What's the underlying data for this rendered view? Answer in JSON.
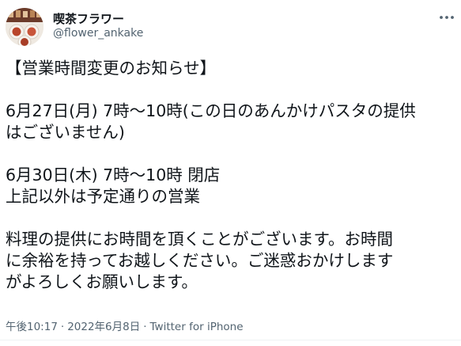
{
  "author": {
    "display_name": "喫茶フラワー",
    "handle": "@flower_ankake",
    "avatar_icon": "avatar-photo-icon"
  },
  "more_icon": "more-horizontal-icon",
  "tweet": {
    "lines": [
      "【営業時間変更のお知らせ】",
      "",
      "6月27日(月) 7時～10時(この日のあんかけパスタの提供",
      "はございません)",
      "",
      "6月30日(木) 7時～10時 閉店",
      "上記以外は予定通りの営業",
      "",
      "料理の提供にお時間を頂くことがございます。お時間",
      "に余裕を持ってお越しください。ご迷惑おかけします",
      "がよろしくお願いします。"
    ]
  },
  "meta": {
    "time": "午後10:17",
    "separator": "·",
    "date": "2022年6月8日",
    "source": "Twitter for iPhone"
  },
  "colors": {
    "text": "#0f1419",
    "secondary": "#536471",
    "divider": "#eff3f4"
  }
}
